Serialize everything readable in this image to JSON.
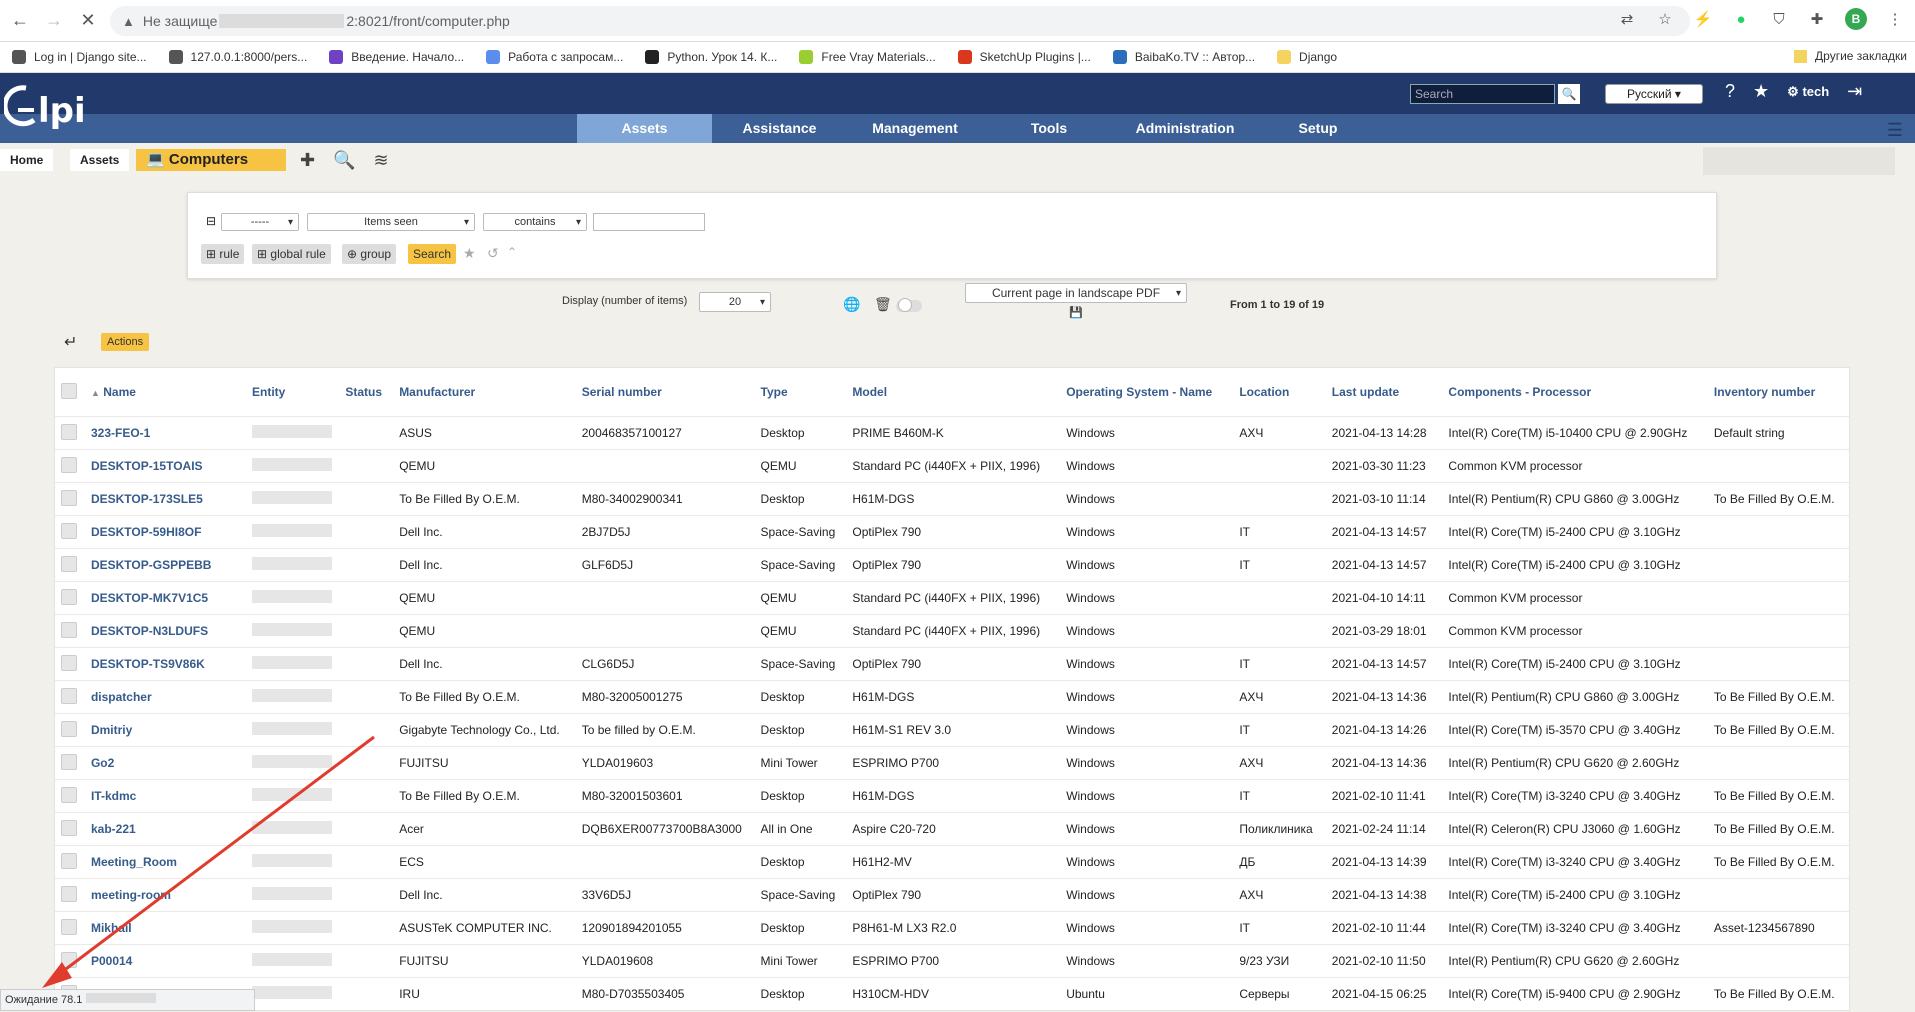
{
  "browser": {
    "url_prefix": "Не защище",
    "url_suffix": "2:8021/front/computer.php",
    "profile_initial": "B",
    "bookmarks": [
      {
        "label": "Log in | Django site...",
        "color": "#555"
      },
      {
        "label": "127.0.0.1:8000/pers...",
        "color": "#555"
      },
      {
        "label": "Введение. Начало...",
        "color": "#6f42c1"
      },
      {
        "label": "Работа с запросам...",
        "color": "#5b8def"
      },
      {
        "label": "Python. Урок 14. К...",
        "color": "#222"
      },
      {
        "label": "Free Vray Materials...",
        "color": "#9acd32"
      },
      {
        "label": "SketchUp Plugins |...",
        "color": "#d9381e"
      },
      {
        "label": "BaibaKo.TV :: Автор...",
        "color": "#2a6ebb"
      },
      {
        "label": "Django",
        "color": "#f4d35e"
      }
    ],
    "other_bookmarks": "Другие закладки",
    "status_text": "Ожидание 78.1"
  },
  "header": {
    "logo": "Glpi",
    "search_placeholder": "Search",
    "language": "Русский",
    "user": "tech"
  },
  "menu": [
    "Assets",
    "Assistance",
    "Management",
    "Tools",
    "Administration",
    "Setup"
  ],
  "breadcrumb": {
    "home": "Home",
    "assets": "Assets",
    "current": "Computers"
  },
  "search": {
    "field1": "-----",
    "field2": "Items seen",
    "field3": "contains",
    "rule": "rule",
    "global_rule": "global rule",
    "group": "group",
    "search_btn": "Search"
  },
  "display": {
    "label": "Display (number of items)",
    "count": "20",
    "export": "Current page in landscape PDF",
    "range": "From 1 to 19 of 19",
    "actions": "Actions"
  },
  "table": {
    "columns": [
      "Name",
      "Entity",
      "Status",
      "Manufacturer",
      "Serial number",
      "Type",
      "Model",
      "Operating System - Name",
      "Location",
      "Last update",
      "Components - Processor",
      "Inventory number"
    ],
    "rows": [
      [
        "323-FEO-1",
        "",
        "",
        "ASUS",
        "200468357100127",
        "Desktop",
        "PRIME B460M-K",
        "Windows",
        "АХЧ",
        "2021-04-13 14:28",
        "Intel(R) Core(TM) i5-10400 CPU @ 2.90GHz",
        "Default string"
      ],
      [
        "DESKTOP-15TOAIS",
        "",
        "",
        "QEMU",
        "",
        "QEMU",
        "Standard PC (i440FX + PIIX, 1996)",
        "Windows",
        "",
        "2021-03-30 11:23",
        "Common KVM processor",
        ""
      ],
      [
        "DESKTOP-173SLE5",
        "",
        "",
        "To Be Filled By O.E.M.",
        "M80-34002900341",
        "Desktop",
        "H61M-DGS",
        "Windows",
        "",
        "2021-03-10 11:14",
        "Intel(R) Pentium(R) CPU G860 @ 3.00GHz",
        "To Be Filled By O.E.M."
      ],
      [
        "DESKTOP-59HI8OF",
        "",
        "",
        "Dell Inc.",
        "2BJ7D5J",
        "Space-Saving",
        "OptiPlex 790",
        "Windows",
        "IT",
        "2021-04-13 14:57",
        "Intel(R) Core(TM) i5-2400 CPU @ 3.10GHz",
        ""
      ],
      [
        "DESKTOP-GSPPEBB",
        "",
        "",
        "Dell Inc.",
        "GLF6D5J",
        "Space-Saving",
        "OptiPlex 790",
        "Windows",
        "IT",
        "2021-04-13 14:57",
        "Intel(R) Core(TM) i5-2400 CPU @ 3.10GHz",
        ""
      ],
      [
        "DESKTOP-MK7V1C5",
        "",
        "",
        "QEMU",
        "",
        "QEMU",
        "Standard PC (i440FX + PIIX, 1996)",
        "Windows",
        "",
        "2021-04-10 14:11",
        "Common KVM processor",
        ""
      ],
      [
        "DESKTOP-N3LDUFS",
        "",
        "",
        "QEMU",
        "",
        "QEMU",
        "Standard PC (i440FX + PIIX, 1996)",
        "Windows",
        "",
        "2021-03-29 18:01",
        "Common KVM processor",
        ""
      ],
      [
        "DESKTOP-TS9V86K",
        "",
        "",
        "Dell Inc.",
        "CLG6D5J",
        "Space-Saving",
        "OptiPlex 790",
        "Windows",
        "IT",
        "2021-04-13 14:57",
        "Intel(R) Core(TM) i5-2400 CPU @ 3.10GHz",
        ""
      ],
      [
        "dispatcher",
        "",
        "",
        "To Be Filled By O.E.M.",
        "M80-32005001275",
        "Desktop",
        "H61M-DGS",
        "Windows",
        "АХЧ",
        "2021-04-13 14:36",
        "Intel(R) Pentium(R) CPU G860 @ 3.00GHz",
        "To Be Filled By O.E.M."
      ],
      [
        "Dmitriy",
        "",
        "",
        "Gigabyte Technology Co., Ltd.",
        "To be filled by O.E.M.",
        "Desktop",
        "H61M-S1 REV 3.0",
        "Windows",
        "IT",
        "2021-04-13 14:26",
        "Intel(R) Core(TM) i5-3570 CPU @ 3.40GHz",
        "To Be Filled By O.E.M."
      ],
      [
        "Go2",
        "",
        "",
        "FUJITSU",
        "YLDA019603",
        "Mini Tower",
        "ESPRIMO P700",
        "Windows",
        "АХЧ",
        "2021-04-13 14:36",
        "Intel(R) Pentium(R) CPU G620 @ 2.60GHz",
        ""
      ],
      [
        "IT-kdmc",
        "",
        "",
        "To Be Filled By O.E.M.",
        "M80-32001503601",
        "Desktop",
        "H61M-DGS",
        "Windows",
        "IT",
        "2021-02-10 11:41",
        "Intel(R) Core(TM) i3-3240 CPU @ 3.40GHz",
        "To Be Filled By O.E.M."
      ],
      [
        "kab-221",
        "",
        "",
        "Acer",
        "DQB6XER00773700B8A3000",
        "All in One",
        "Aspire C20-720",
        "Windows",
        "Поликлиника",
        "2021-02-24 11:14",
        "Intel(R) Celeron(R) CPU J3060 @ 1.60GHz",
        "To Be Filled By O.E.M."
      ],
      [
        "Meeting_Room",
        "",
        "",
        "ECS",
        "",
        "Desktop",
        "H61H2-MV",
        "Windows",
        "ДБ",
        "2021-04-13 14:39",
        "Intel(R) Core(TM) i3-3240 CPU @ 3.40GHz",
        "To Be Filled By O.E.M."
      ],
      [
        "meeting-room",
        "",
        "",
        "Dell Inc.",
        "33V6D5J",
        "Space-Saving",
        "OptiPlex 790",
        "Windows",
        "АХЧ",
        "2021-04-13 14:38",
        "Intel(R) Core(TM) i5-2400 CPU @ 3.10GHz",
        ""
      ],
      [
        "Mikhail",
        "",
        "",
        "ASUSTeK COMPUTER INC.",
        "120901894201055",
        "Desktop",
        "P8H61-M LX3 R2.0",
        "Windows",
        "IT",
        "2021-02-10 11:44",
        "Intel(R) Core(TM) i3-3240 CPU @ 3.40GHz",
        "Asset-1234567890"
      ],
      [
        "P00014",
        "",
        "",
        "FUJITSU",
        "YLDA019608",
        "Mini Tower",
        "ESPRIMO P700",
        "Windows",
        "9/23 УЗИ",
        "2021-02-10 11:50",
        "Intel(R) Pentium(R) CPU G620 @ 2.60GHz",
        ""
      ],
      [
        "",
        "",
        "",
        "IRU",
        "M80-D7035503405",
        "Desktop",
        "H310CM-HDV",
        "Ubuntu",
        "Серверы",
        "2021-04-15 06:25",
        "Intel(R) Core(TM) i5-9400 CPU @ 2.90GHz",
        "To Be Filled By O.E.M."
      ]
    ]
  }
}
